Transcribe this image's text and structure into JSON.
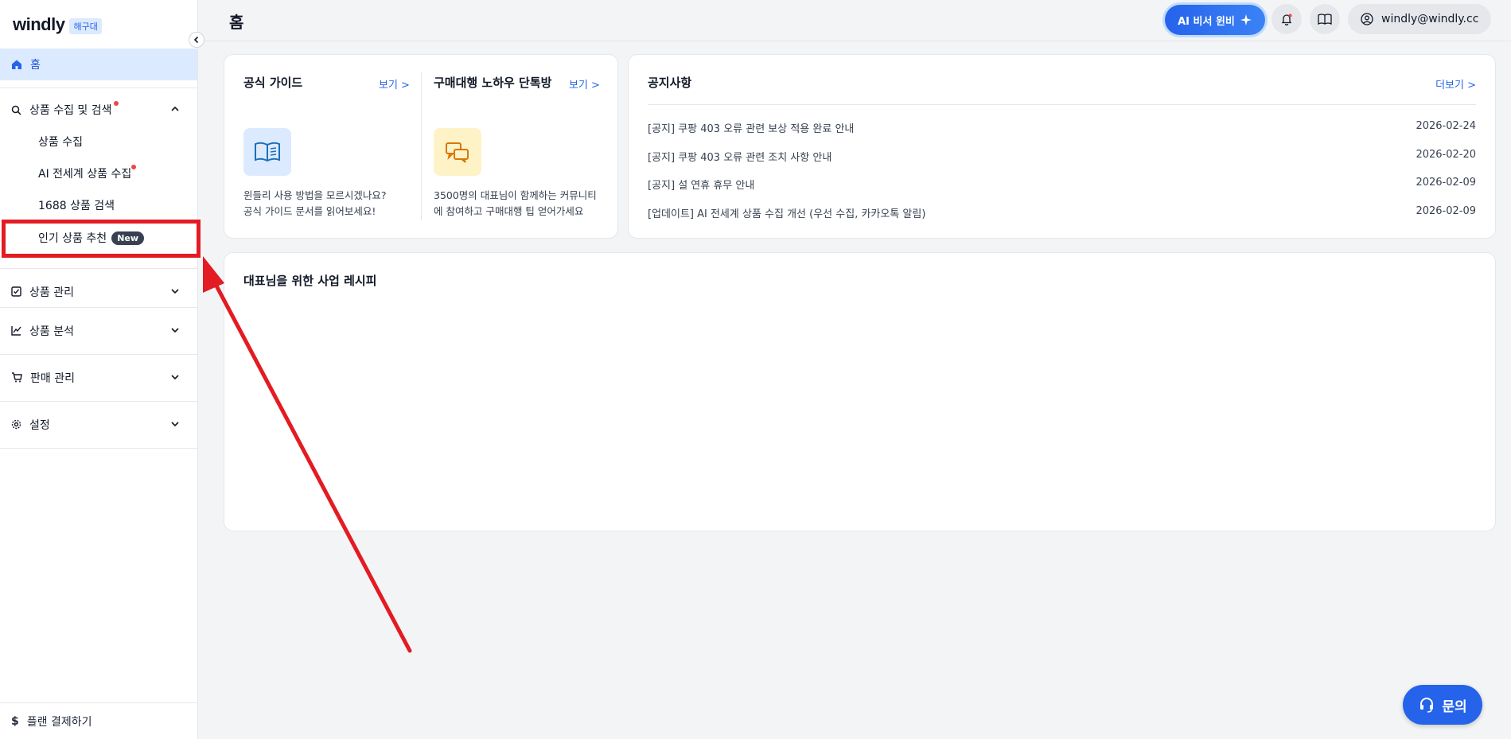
{
  "sidebar": {
    "brand": "windly",
    "brand_badge": "해구대",
    "home_label": "홈",
    "groups": [
      {
        "label": "상품 수집 및 검색",
        "sub_items": [
          "상품 수집",
          "AI 전세계 상품 수집",
          "1688 상품 검색",
          "인기 상품 추천"
        ]
      },
      {
        "label": "상품 관리"
      },
      {
        "label": "상품 분석"
      },
      {
        "label": "판매 관리"
      },
      {
        "label": "설정"
      }
    ],
    "new_badge": "New",
    "bottom_label": "플랜 결제하기"
  },
  "header": {
    "title": "홈",
    "ai_button": "AI 비서 윈비",
    "user_email": "windly@windly.cc"
  },
  "guide": {
    "title": "공식 가이드",
    "link": "보기 >",
    "desc_line1": "윈들리 사용 방법을 모르시겠나요?",
    "desc_line2": "공식 가이드 문서를 읽어보세요!"
  },
  "community": {
    "title": "구매대행 노하우 단톡방",
    "link": "보기 >",
    "desc_line1": "3500명의 대표님이 함께하는 커뮤니티",
    "desc_line2": "에 참여하고 구매대행 팁 얻어가세요"
  },
  "notices": {
    "title": "공지사항",
    "more": "더보기 >",
    "items": [
      {
        "text": "[공지] 쿠팡 403 오류 관련 보상 적용 완료 안내",
        "date": "2026-02-24"
      },
      {
        "text": "[공지] 쿠팡 403 오류 관련 조치 사항 안내",
        "date": "2026-02-20"
      },
      {
        "text": "[공지] 설 연휴 휴무 안내",
        "date": "2026-02-09"
      },
      {
        "text": "[업데이트] AI 전세계 상품 수집 개선 (우선 수집, 카카오톡 알림)",
        "date": "2026-02-09"
      }
    ]
  },
  "recipe": {
    "title": "대표님을 위한 사업 레시피"
  },
  "help_button": "문의",
  "colors": {
    "accent": "#2563eb",
    "highlight": "#e31b23",
    "active_bg": "#dbeafe",
    "dot": "#ef4444"
  }
}
